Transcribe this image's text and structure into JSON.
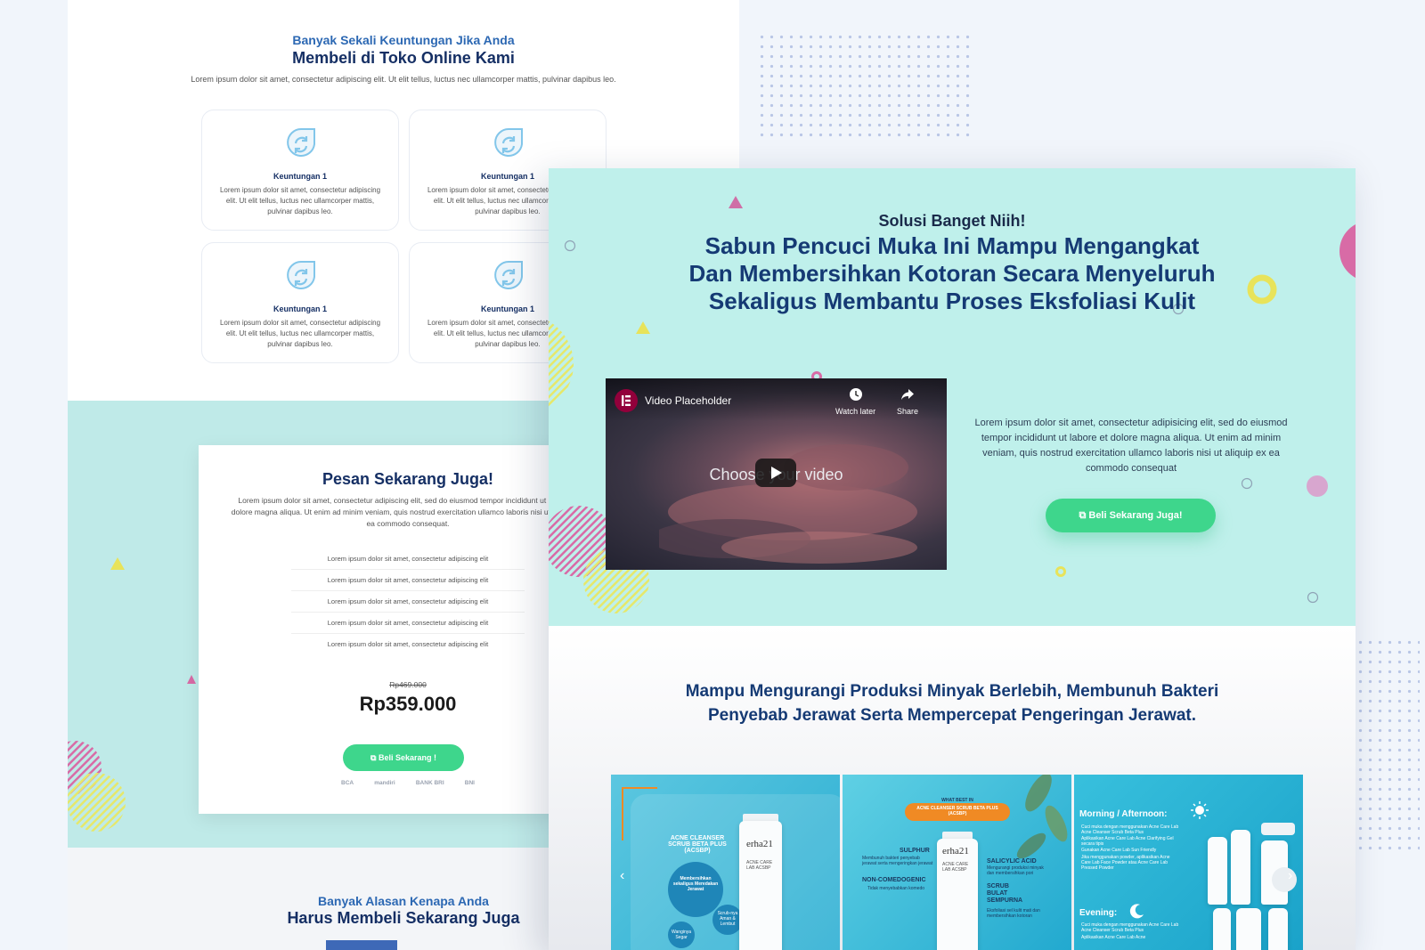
{
  "colors": {
    "navy": "#152f64",
    "blue": "#2c68b3",
    "mint": "#bff0eb",
    "green": "#3ed68c",
    "pink": "#d86ba6",
    "yellow": "#e8e35a"
  },
  "back_page": {
    "benefits": {
      "subtitle": "Banyak Sekali Keuntungan Jika Anda",
      "title": "Membeli di Toko Online Kami",
      "description": "Lorem ipsum dolor sit amet, consectetur adipiscing elit. Ut elit tellus, luctus nec ullamcorper mattis, pulvinar dapibus leo.",
      "cards": [
        {
          "icon": "refresh-icon",
          "title": "Keuntungan 1",
          "text": "Lorem ipsum dolor sit amet, consectetur adipiscing elit. Ut elit tellus, luctus nec ullamcorper mattis, pulvinar dapibus leo."
        },
        {
          "icon": "refresh-icon",
          "title": "Keuntungan 1",
          "text": "Lorem ipsum dolor sit amet, consectetur adipiscing elit. Ut elit tellus, luctus nec ullamcorper mattis, pulvinar dapibus leo."
        },
        {
          "icon": "refresh-icon",
          "title": "Keuntungan 1",
          "text": "Lorem ipsum dolor sit amet, consectetur adipiscing elit. Ut elit tellus, luctus nec ullamcorper mattis, pulvinar dapibus leo."
        },
        {
          "icon": "refresh-icon",
          "title": "Keuntungan 1",
          "text": "Lorem ipsum dolor sit amet, consectetur adipiscing elit. Ut elit tellus, luctus nec ullamcorper mattis, pulvinar dapibus leo."
        }
      ]
    },
    "order": {
      "title": "Pesan Sekarang Juga!",
      "description": "Lorem ipsum dolor sit amet, consectetur adipiscing elit, sed do eiusmod tempor incididunt ut labore et dolore magna aliqua. Ut enim ad minim veniam, quis nostrud exercitation ullamco laboris nisi ut aliquip ex ea commodo consequat.",
      "features": [
        "Lorem ipsum dolor sit amet, consectetur adipiscing elit",
        "Lorem ipsum dolor sit amet, consectetur adipiscing elit",
        "Lorem ipsum dolor sit amet, consectetur adipiscing elit",
        "Lorem ipsum dolor sit amet, consectetur adipiscing elit",
        "Lorem ipsum dolor sit amet, consectetur adipiscing elit"
      ],
      "old_price": "Rp469.000",
      "price": "Rp359.000",
      "button_label": "Beli Sekarang !",
      "banks": [
        "BCA",
        "mandiri",
        "BANK BRI",
        "BNI"
      ]
    },
    "reasons": {
      "subtitle": "Banyak Alasan Kenapa Anda",
      "title": "Harus Membeli Sekarang Juga"
    }
  },
  "front_page": {
    "hero": {
      "subtitle": "Solusi Banget Niih!",
      "title": "Sabun Pencuci Muka Ini Mampu Mengangkat Dan Membersihkan Kotoran Secara Menyeluruh Sekaligus Membantu Proses Eksfoliasi Kulit"
    },
    "video": {
      "title": "Video Placeholder",
      "watch_later": "Watch later",
      "share": "Share",
      "placeholder_text": "Choose your video"
    },
    "description": "Lorem ipsum dolor sit amet, consectetur adipisicing elit, sed do eiusmod tempor incididunt ut labore et dolore magna aliqua. Ut enim ad minim veniam, quis nostrud exercitation ullamco laboris nisi ut aliquip ex ea commodo consequat",
    "cta_label": "Beli Sekarang Juga!",
    "benefits_heading": "Mampu Mengurangi Produksi Minyak Berlebih, Membunuh Bakteri Penyebab Jerawat Serta Mempercepat Pengeringan Jerawat.",
    "product_tiles": [
      {
        "product_title": "ACNE CLEANSER SCRUB BETA PLUS (ACSBP)",
        "bubble": "Membersihkan sekaligus Meredakan Jerawat",
        "bubble_small": "Scrub-nya Aman & Lembut",
        "bubble_small2": "Wanginya Segar",
        "brand": "erha21",
        "tube_text": "ACNE CARE LAB ACSBP"
      },
      {
        "header_top": "WHAT BEST IN",
        "header_title": "ACNE CLEANSER SCRUB BETA PLUS (ACSBP)",
        "sulphur": "SULPHUR",
        "sulphur_text": "Membunuh bakteri penyebab jerawat serta mengeringkan jerawat",
        "non_comedogenic": "NON-COMEDOGENIC",
        "non_comedogenic_text": "Tidak menyebabkan komedo",
        "salicylic": "SALICYLIC ACID",
        "salicylic_text": "Mengurangi produksi minyak dan membersihkan pori",
        "scrub": "SCRUB BULAT SEMPURNA",
        "scrub_text": "Eksfoliasi sel kulit mati dan membersihkan kotoran",
        "brand": "erha21",
        "tube_text": "ACNE CARE LAB ACSBP"
      },
      {
        "morning": "Morning / Afternoon:",
        "morning_items": [
          "Cuci muka dengan menggunakan Acne Care Lab Acne Cleanser Scrub Beta Plus",
          "Aplikasikan Acne Care Lab Acne Clarifying Gel secara tipis",
          "Gunakan Acne Care Lab Sun Friendly",
          "Jika menggunakan powder, aplikasikan Acne Care Lab Face Powder atau Acne Care Lab Pressed Powder"
        ],
        "evening": "Evening:",
        "evening_items": [
          "Cuci muka dengan menggunakan Acne Care Lab Acne Cleanser Scrub Beta Plus",
          "Aplikasikan Acne Care Lab Acne"
        ]
      }
    ]
  }
}
